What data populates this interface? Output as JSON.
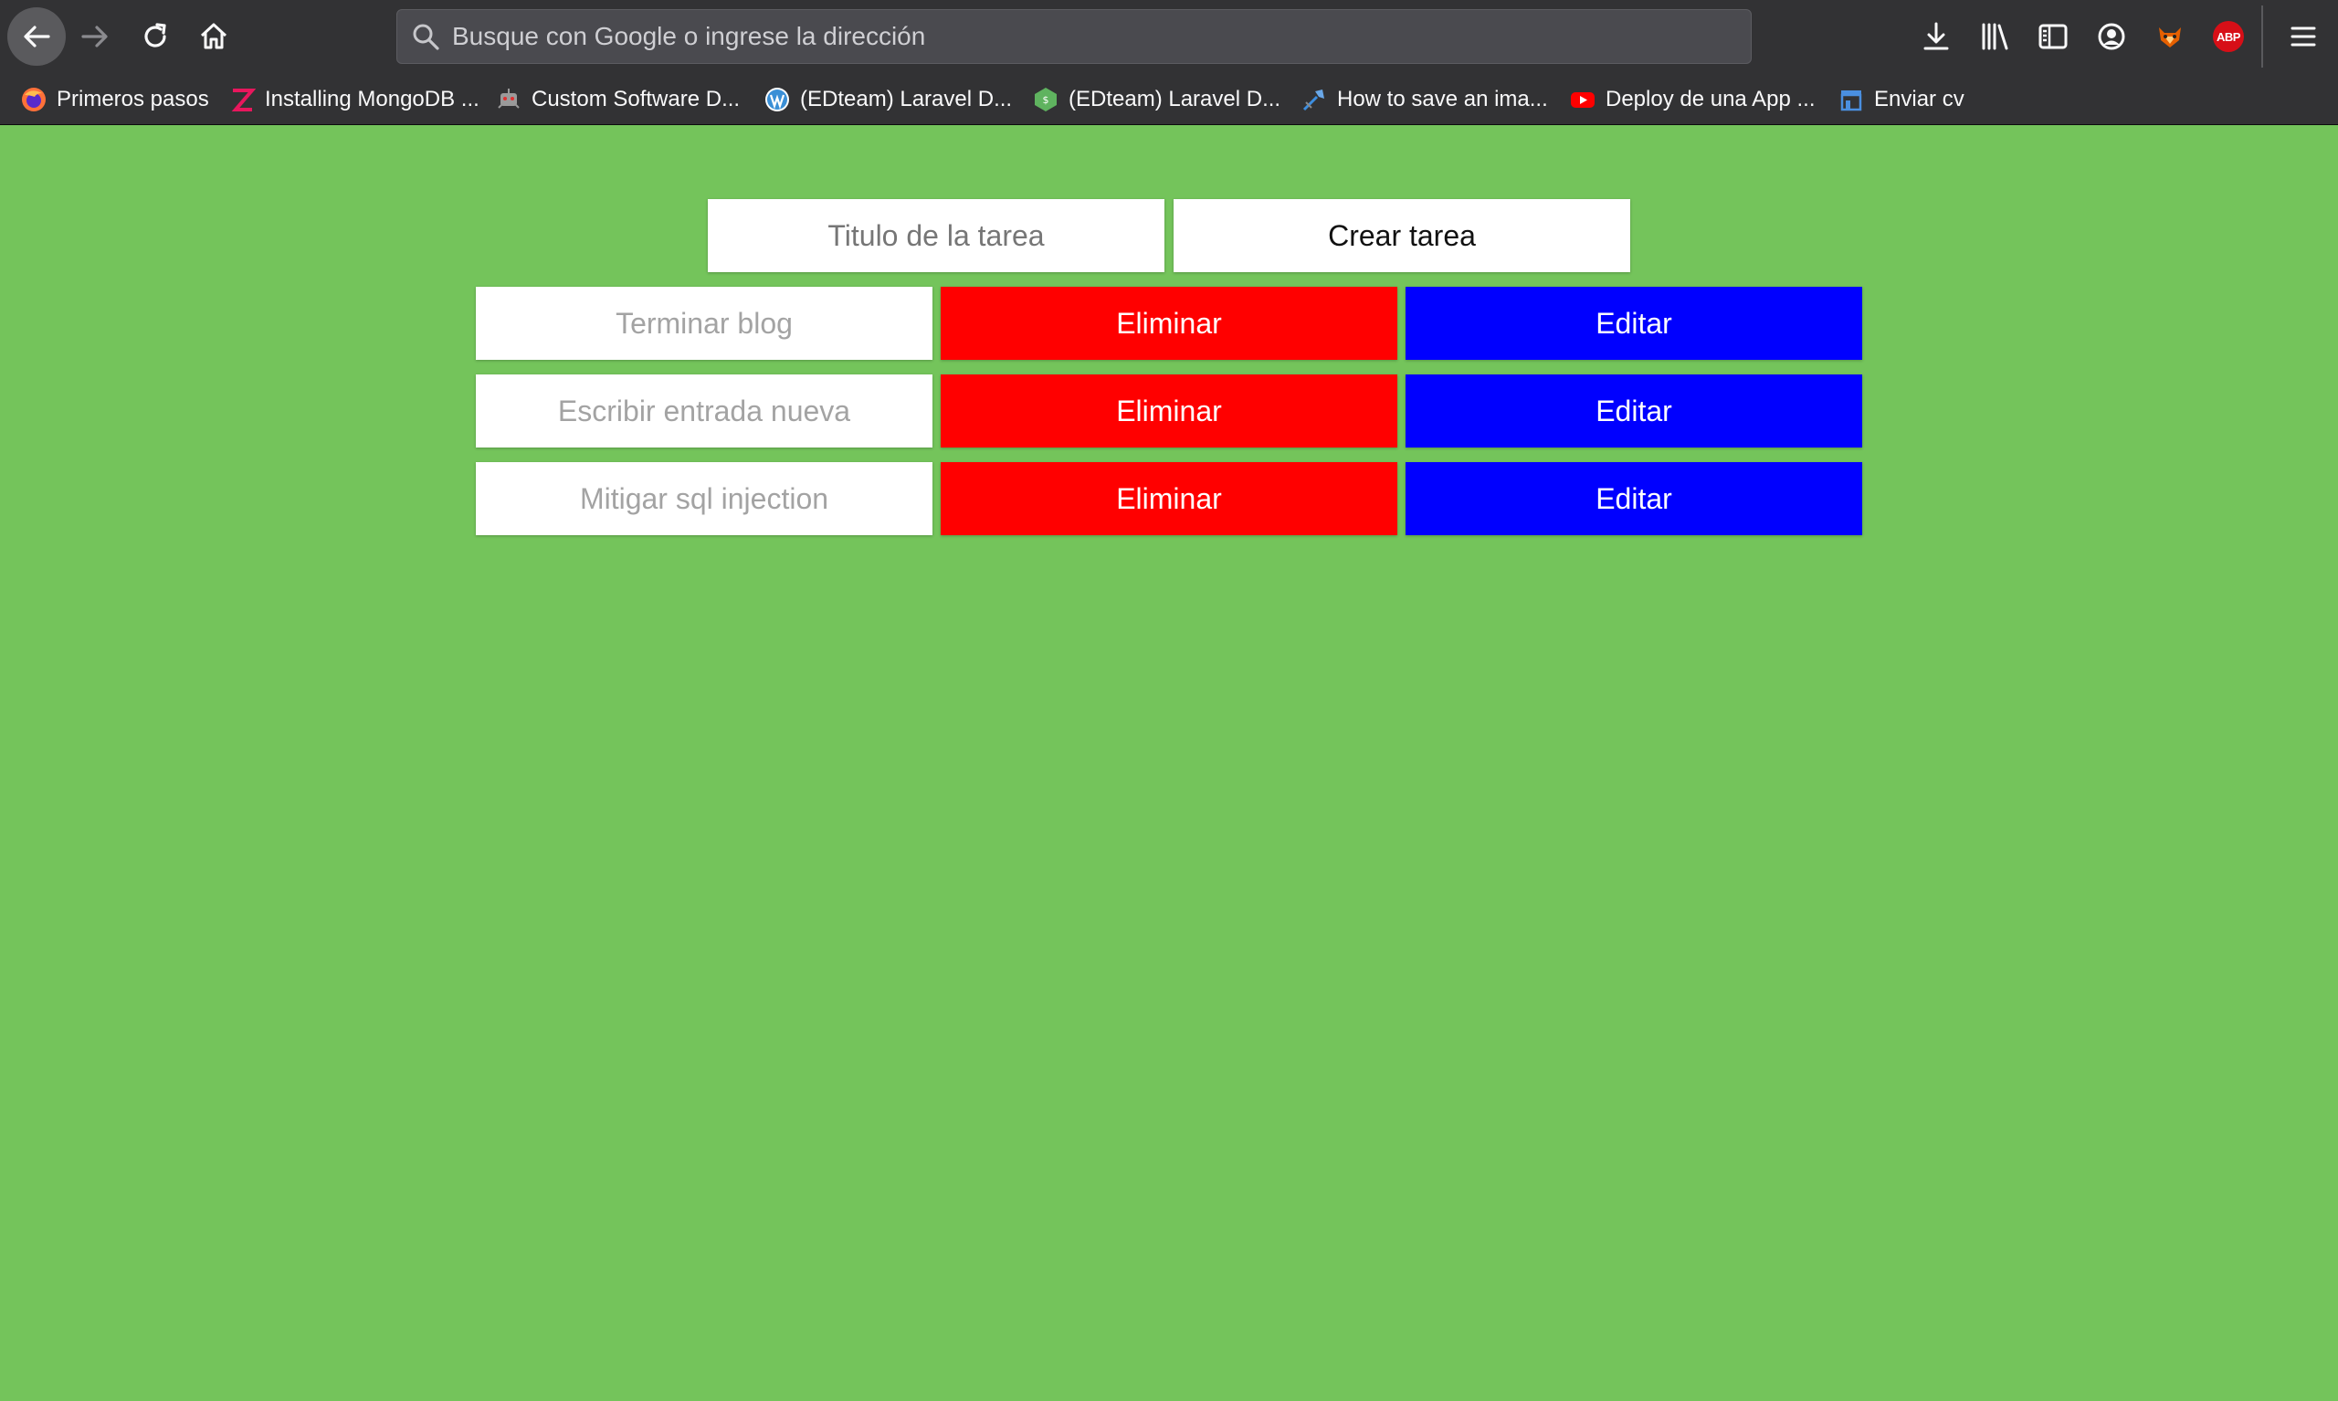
{
  "browser": {
    "urlbar": {
      "placeholder": "Busque con Google o ingrese la dirección"
    },
    "bookmarks": [
      {
        "label": "Primeros pasos",
        "icon": "firefox-icon"
      },
      {
        "label": "Installing MongoDB ...",
        "icon": "zoom-z-icon"
      },
      {
        "label": "Custom Software D...",
        "icon": "robot-icon"
      },
      {
        "label": "(EDteam) Laravel D...",
        "icon": "wordpress-icon"
      },
      {
        "label": "(EDteam) Laravel D...",
        "icon": "shopify-hex-icon"
      },
      {
        "label": "How to save an ima...",
        "icon": "pen-tool-icon"
      },
      {
        "label": "Deploy de una App ...",
        "icon": "youtube-icon"
      },
      {
        "label": "Enviar cv",
        "icon": "store-icon"
      }
    ],
    "abp_label": "ABP"
  },
  "app": {
    "new_task": {
      "placeholder": "Titulo de la tarea",
      "create_label": "Crear tarea"
    },
    "tasks": [
      {
        "title": "Terminar blog",
        "delete_label": "Eliminar",
        "edit_label": "Editar"
      },
      {
        "title": "Escribir entrada nueva",
        "delete_label": "Eliminar",
        "edit_label": "Editar"
      },
      {
        "title": "Mitigar sql injection",
        "delete_label": "Eliminar",
        "edit_label": "Editar"
      }
    ]
  },
  "colors": {
    "page_background": "#74c45b",
    "delete_button": "#ff0000",
    "edit_button": "#0000ff",
    "chrome_background": "#323234"
  }
}
